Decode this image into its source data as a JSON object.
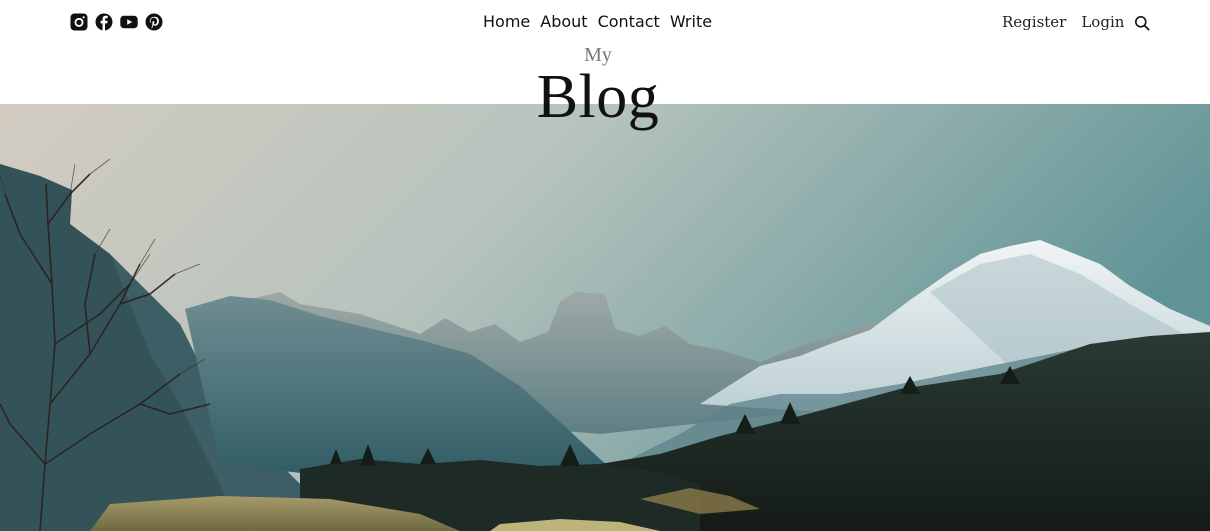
{
  "social": {
    "icons": [
      "instagram-icon",
      "facebook-icon",
      "youtube-icon",
      "pinterest-icon"
    ]
  },
  "nav": {
    "home": "Home",
    "about": "About",
    "contact": "Contact",
    "write": "Write"
  },
  "auth": {
    "register": "Register",
    "login": "Login"
  },
  "search": {
    "icon": "search-icon"
  },
  "header": {
    "subtitle": "My",
    "title": "Blog"
  },
  "hero": {
    "image": "mountain-landscape",
    "colors": {
      "sky_warm": "#d7cfc3",
      "sky_teal": "#6d9a9c",
      "mountain_teal": "#3f6f78",
      "snow": "#e9eef0",
      "forest": "#1f2a24"
    }
  }
}
